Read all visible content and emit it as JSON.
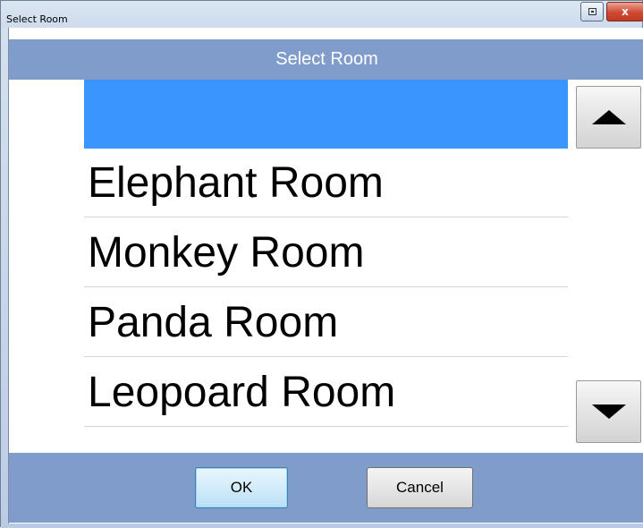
{
  "window": {
    "title": "Select Room",
    "restore_icon": "restore-icon",
    "close_glyph": "x",
    "close_icon": "close-icon"
  },
  "dialog": {
    "header": "Select Room",
    "rooms": [
      {
        "label": "",
        "selected": true
      },
      {
        "label": "Elephant Room",
        "selected": false
      },
      {
        "label": "Monkey Room",
        "selected": false
      },
      {
        "label": "Panda Room",
        "selected": false
      },
      {
        "label": "Leopoard Room",
        "selected": false
      }
    ],
    "scroll_up_icon": "triangle-up-icon",
    "scroll_down_icon": "triangle-down-icon",
    "ok_label": "OK",
    "cancel_label": "Cancel"
  },
  "colors": {
    "header_bg": "#7f9ccb",
    "selection": "#3b95ff",
    "header_text": "#ffffff"
  }
}
